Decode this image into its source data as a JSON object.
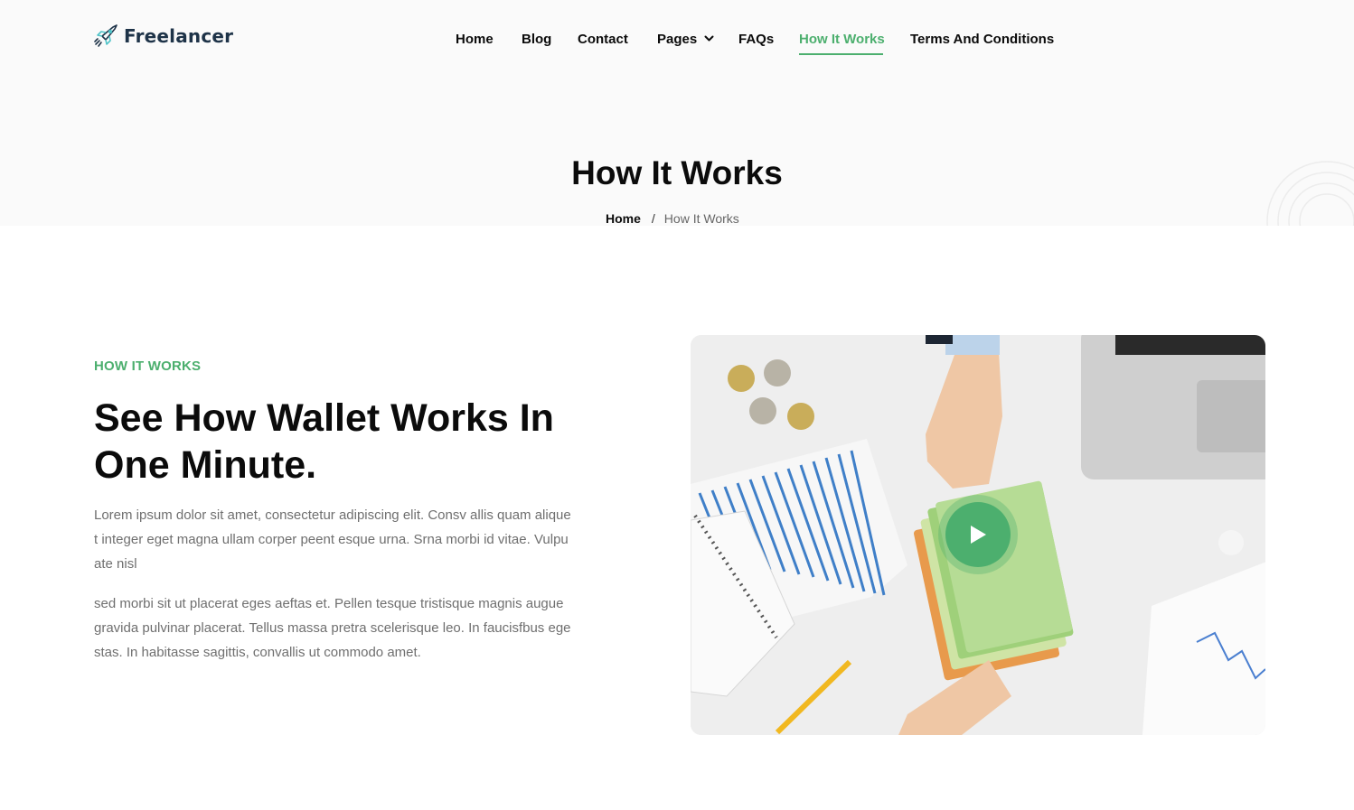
{
  "brand": {
    "name": "Freelancer",
    "icon": "rocket-icon",
    "text_color": "#1e3348",
    "accent_color": "#4caf6e"
  },
  "nav": {
    "items": [
      {
        "label": "Home"
      },
      {
        "label": "Blog"
      },
      {
        "label": "Contact"
      },
      {
        "label": "Pages",
        "dropdown": true
      },
      {
        "label": "FAQs"
      },
      {
        "label": "How It Works",
        "active": true
      },
      {
        "label": "Terms And Conditions"
      }
    ]
  },
  "hero": {
    "title": "How It Works",
    "breadcrumb": {
      "home": "Home",
      "separator": "/",
      "current": "How It Works"
    }
  },
  "section": {
    "eyebrow": "HOW IT WORKS",
    "headline": "See How Wallet Works In One Minute.",
    "paragraphs": [
      "Lorem ipsum dolor sit amet, consectetur adipiscing elit. Consv allis quam aliquet integer eget magna ullam corper peent esque urna. Srna morbi id vitae. Vulpuate nisl",
      "sed morbi sit ut placerat eges aeftas et. Pellen tesque tristisque magnis augue gravida pulvinar placerat. Tellus massa pretra scelerisque leo. In faucisfbus egestas. In habitasse sagittis, convallis ut commodo amet."
    ]
  },
  "video": {
    "play_icon": "play-icon",
    "image": "money-exchange-desk-photo"
  }
}
